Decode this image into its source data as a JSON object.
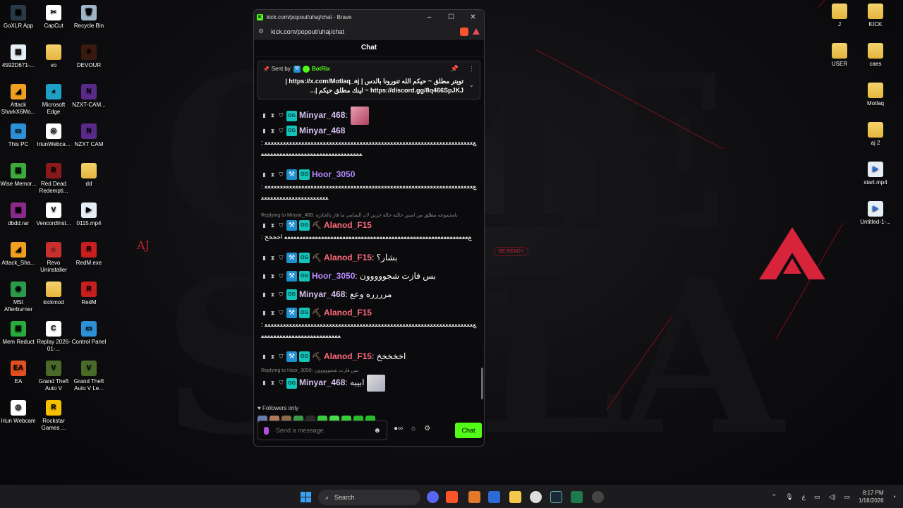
{
  "desktop": {
    "left_icons": [
      {
        "label": "GoXLR App",
        "color": "#2a3a46",
        "glyph": "▦"
      },
      {
        "label": "CapCut",
        "color": "#ffffff",
        "glyph": "✂"
      },
      {
        "label": "Recycle Bin",
        "color": "#9fb6c9",
        "glyph": "🗑"
      },
      {
        "label": "4592D671-...",
        "color": "#e6eef5",
        "glyph": "▤"
      },
      {
        "label": "vo",
        "color": "folder",
        "glyph": ""
      },
      {
        "label": "DEVOUR",
        "color": "#3a1a10",
        "glyph": "✶"
      },
      {
        "label": "Attack SharkX6Mo...",
        "color": "#f0a020",
        "glyph": "◢"
      },
      {
        "label": "Microsoft Edge",
        "color": "#1fa0c8",
        "glyph": "◕"
      },
      {
        "label": "NZXT-CAM...",
        "color": "#5a2a8a",
        "glyph": "N"
      },
      {
        "label": "This PC",
        "color": "#2d8fd6",
        "glyph": "▭"
      },
      {
        "label": "IriunWebca...",
        "color": "#ffffff",
        "glyph": "◎"
      },
      {
        "label": "NZXT CAM",
        "color": "#5a2a8a",
        "glyph": "N"
      },
      {
        "label": "Wise Memor...",
        "color": "#3caa3c",
        "glyph": "▥"
      },
      {
        "label": "Red Dead Redempti...",
        "color": "#8a1a1a",
        "glyph": "R"
      },
      {
        "label": "dd",
        "color": "folder",
        "glyph": ""
      },
      {
        "label": "dbdd.rar",
        "color": "#8a2a8a",
        "glyph": "▩"
      },
      {
        "label": "VencordInst...",
        "color": "#ffffff",
        "glyph": "V"
      },
      {
        "label": "0115.mp4",
        "color": "#e6eef5",
        "glyph": "▶"
      },
      {
        "label": "Attack_Sha...",
        "color": "#f0a020",
        "glyph": "◢"
      },
      {
        "label": "Revo Uninstaller",
        "color": "#c83030",
        "glyph": "⌂"
      },
      {
        "label": "RedM.exe",
        "color": "#c81e1e",
        "glyph": "R"
      },
      {
        "label": "MSI Afterburner",
        "color": "#2a9a4a",
        "glyph": "◉"
      },
      {
        "label": "kickmod",
        "color": "folder",
        "glyph": ""
      },
      {
        "label": "RedM",
        "color": "#c81e1e",
        "glyph": "R"
      },
      {
        "label": "Mem Reduct",
        "color": "#2aaa3a",
        "glyph": "▤"
      },
      {
        "label": "Replay 2026-01-...",
        "color": "#ffffff",
        "glyph": "C"
      },
      {
        "label": "Control Panel",
        "color": "#2d8fd6",
        "glyph": "▭"
      },
      {
        "label": "EA",
        "color": "#e05020",
        "glyph": "EA"
      },
      {
        "label": "Grand Theft Auto V",
        "color": "#4a6a2a",
        "glyph": "V"
      },
      {
        "label": "Grand Theft Auto V Le...",
        "color": "#4a6a2a",
        "glyph": "V"
      },
      {
        "label": "Iriun Webcam",
        "color": "#ffffff",
        "glyph": "◎"
      },
      {
        "label": "Rockstar Games ...",
        "color": "#f5c000",
        "glyph": "R"
      }
    ],
    "right_icons": [
      {
        "label": "J",
        "color": "folder"
      },
      {
        "label": "KICK",
        "color": "folder"
      },
      {
        "label": "USER",
        "color": "folder"
      },
      {
        "label": "caes",
        "color": "folder"
      },
      {
        "label": "Motlaq",
        "color": "folder"
      },
      {
        "label": "aj 2",
        "color": "folder"
      },
      {
        "label": "start.mp4",
        "color": "file"
      },
      {
        "label": "Untitled-1-...",
        "color": "file"
      }
    ],
    "aj_label": "AJ",
    "ready_label": "BE READY"
  },
  "browser": {
    "title": "kick.com/popout/uhaj/chat - Brave",
    "url": "kick.com/popout/uhaj/chat",
    "controls": {
      "minimize": "–",
      "maximize": "☐",
      "close": "✕"
    }
  },
  "chat": {
    "header": "Chat",
    "pinned": {
      "sent_by": "Sent by",
      "bot": "BotRix",
      "line1": "تويتر مطلق ~ حيكم الله تنورونا بالدس | https://x.com/Motlaq_aj |",
      "line2": "https://discord.gg/8q466SpJKJ ~ لينك مطلق حيكم |...",
      "pin_icon": "📌",
      "more_icon": "⋮",
      "chevron": "⌄"
    },
    "messages": [
      {
        "user": "Minyar_468",
        "color": "#d8c4f0",
        "text": ":",
        "mod": false,
        "pick": false,
        "avatar": true,
        "reply": ""
      },
      {
        "user": "Minyar_468",
        "color": "#d8c4f0",
        "text": ": ﻊﻌﻌﻌﻌﻌﻌﻌﻌﻌﻌﻌﻌﻌﻌﻌﻌﻌﻌﻌﻌﻌﻌﻌﻌﻌﻌﻌﻌﻌﻌﻌﻌﻌﻌﻌﻌﻌﻌﻌﻌﻌﻌﻌﻌﻌﻌﻌﻌﻌﻌﻌﻌﻌﻌﻌﻌﻌﻌﻌﻌﻌﻌﻌﻌﻌﻌﻌﻌﻌﻌﻌﻌﻌﻌﻌﻌﻌﻌﻌﻌﻌﻌﻌﻌﻌﻌﻌﻌﻌﻌﻌﻌﻌﻌﻌﻌﻌﻌﻌﻌﻌ",
        "mod": false,
        "pick": false,
        "avatar": false,
        "reply": ""
      },
      {
        "user": "Hoor_3050",
        "color": "#b98bff",
        "text": ": ﻊﻌﻌﻌﻌﻌﻌﻌﻌﻌﻌﻌﻌﻌﻌﻌﻌﻌﻌﻌﻌﻌﻌﻌﻌﻌﻌﻌﻌﻌﻌﻌﻌﻌﻌﻌﻌﻌﻌﻌﻌﻌﻌﻌﻌﻌﻌﻌﻌﻌﻌﻌﻌﻌﻌﻌﻌﻌﻌﻌﻌﻌﻌﻌﻌﻌﻌﻌﻌﻌﻌﻌﻌﻌﻌﻌﻌﻌﻌﻌﻌﻌﻌﻌﻌﻌﻌﻌﻌﻌﻌ",
        "mod": true,
        "pick": false,
        "avatar": false,
        "reply": ""
      },
      {
        "user": "Alanod_F15",
        "color": "#ff6a7a",
        "text": ": ﻊﻌﻌﻌﻌﻌﻌﻌﻌﻌﻌﻌﻌﻌﻌﻌﻌﻌﻌﻌﻌﻌﻌﻌﻌﻌﻌﻌﻌﻌﻌﻌﻌﻌﻌﻌﻌﻌﻌﻌﻌﻌﻌﻌﻌﻌﻌﻌﻌﻌﻌﻌﻌﻌﻌﻌﻌﻌﻌﻌﻌ اخخخخ",
        "mod": true,
        "pick": true,
        "avatar": false,
        "reply": "Replying to Minyar_468: بامجموعه مطلق من امس حالته حالة حزين لان الشامي ما فاز بالجائزه"
      },
      {
        "user": "Alanod_F15",
        "color": "#ff6a7a",
        "text": ": بشار؟",
        "mod": true,
        "pick": true,
        "avatar": false,
        "reply": ""
      },
      {
        "user": "Hoor_3050",
        "color": "#b98bff",
        "text": ": بس فازت شجووووون",
        "mod": true,
        "pick": false,
        "avatar": false,
        "reply": ""
      },
      {
        "user": "Minyar_468",
        "color": "#d8c4f0",
        "text": ": مرررره وعع",
        "mod": false,
        "pick": false,
        "avatar": false,
        "reply": ""
      },
      {
        "user": "Alanod_F15",
        "color": "#ff6a7a",
        "text": ": ﻊﻌﻌﻌﻌﻌﻌﻌﻌﻌﻌﻌﻌﻌﻌﻌﻌﻌﻌﻌﻌﻌﻌﻌﻌﻌﻌﻌﻌﻌﻌﻌﻌﻌﻌﻌﻌﻌﻌﻌﻌﻌﻌﻌﻌﻌﻌﻌﻌﻌﻌﻌﻌﻌﻌﻌﻌﻌﻌﻌﻌﻌﻌﻌﻌﻌﻌﻌﻌﻌﻌﻌﻌﻌﻌﻌﻌﻌﻌﻌﻌﻌﻌﻌﻌﻌﻌﻌﻌﻌﻌﻌﻌﻌﻌ",
        "mod": true,
        "pick": true,
        "avatar": false,
        "reply": ""
      },
      {
        "user": "Alanod_F15",
        "color": "#ff6a7a",
        "text": ": اخخخخخ",
        "mod": true,
        "pick": true,
        "avatar": false,
        "reply": ""
      },
      {
        "user": "Minyar_468",
        "color": "#d8c4f0",
        "text": ": ابيبه",
        "mod": false,
        "pick": false,
        "avatar2": true,
        "reply": "Replying to Hoor_3050: بس فازت شجووووون"
      }
    ],
    "followers_only": "Followers only",
    "input_placeholder": "Send a message",
    "send_label": "Chat"
  },
  "taskbar": {
    "search_placeholder": "Search",
    "time": "8:17 PM",
    "date": "1/18/2026",
    "lang": "ع"
  }
}
